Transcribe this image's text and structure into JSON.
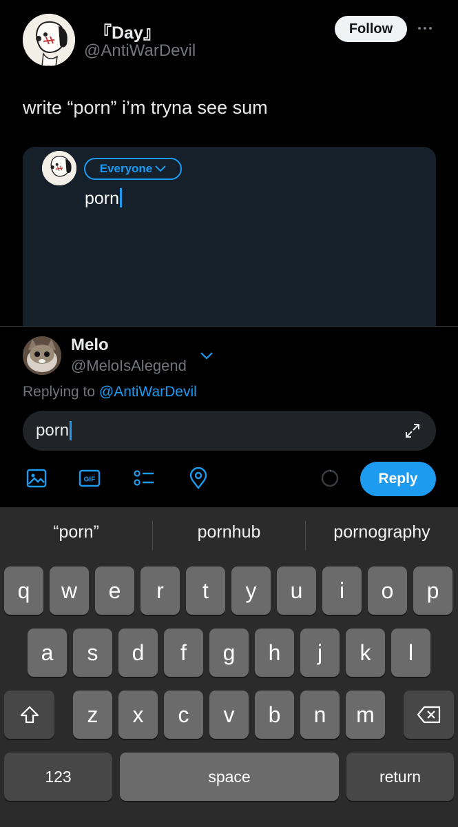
{
  "tweet": {
    "display_name": "『Day』",
    "handle": "@AntiWarDevil",
    "follow_label": "Follow",
    "text": "write “porn” i’m tryna see sum",
    "media": {
      "audience_label": "Everyone",
      "typed_text": "porn"
    }
  },
  "composer": {
    "name": "Melo",
    "handle": "@MeloIsAlegend",
    "replying_prefix": "Replying to ",
    "replying_mention": "@AntiWarDevil",
    "input_value": "porn",
    "reply_label": "Reply",
    "gif_label": "GIF",
    "accent_color": "#1d9bf0"
  },
  "keyboard": {
    "suggestions": [
      "“porn”",
      "pornhub",
      "pornography"
    ],
    "row1": [
      "q",
      "w",
      "e",
      "r",
      "t",
      "y",
      "u",
      "i",
      "o",
      "p"
    ],
    "row2": [
      "a",
      "s",
      "d",
      "f",
      "g",
      "h",
      "j",
      "k",
      "l"
    ],
    "row3": [
      "z",
      "x",
      "c",
      "v",
      "b",
      "n",
      "m"
    ],
    "numbers_label": "123",
    "space_label": "space",
    "return_label": "return"
  }
}
